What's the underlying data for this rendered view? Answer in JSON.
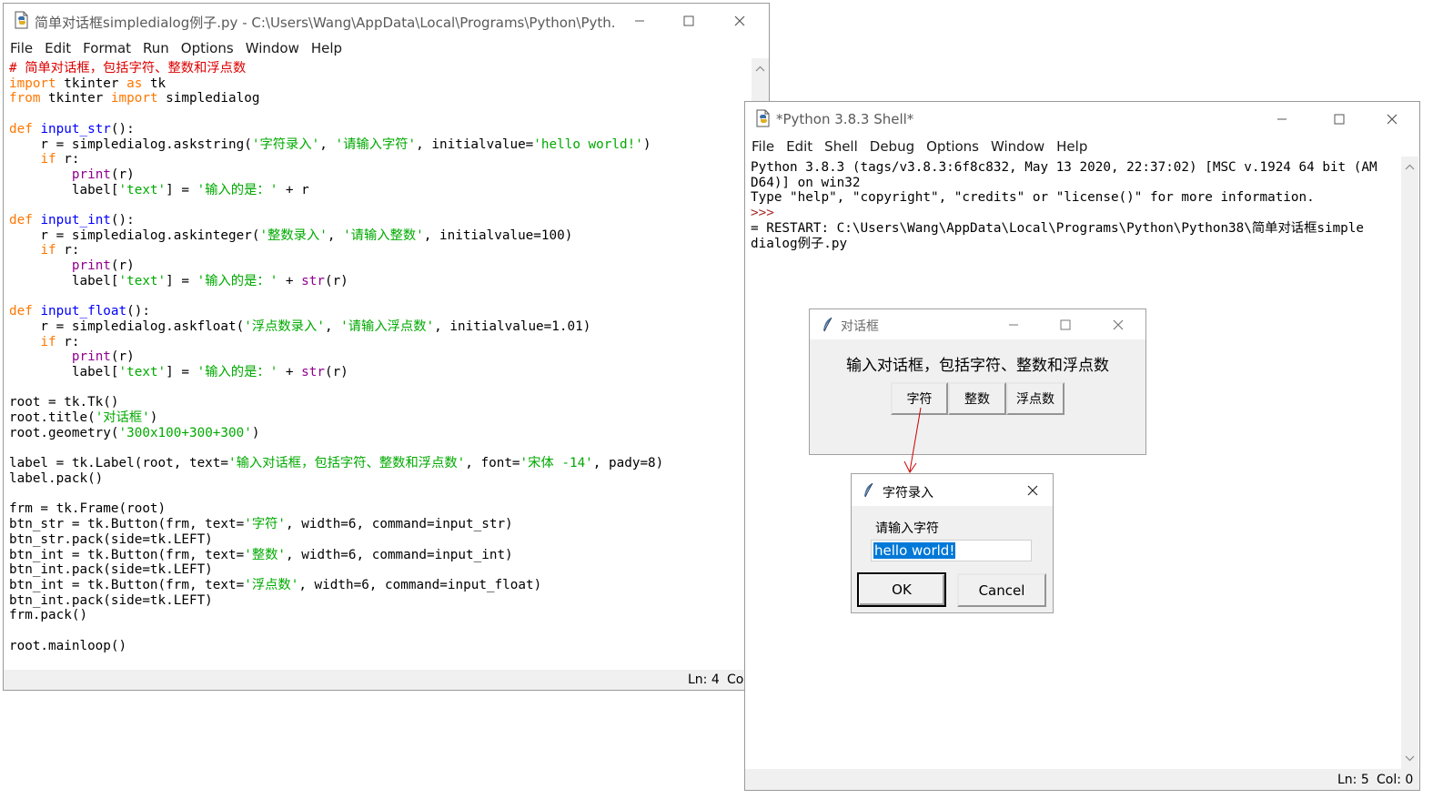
{
  "editor": {
    "title": "简单对话框simpledialog例子.py - C:\\Users\\Wang\\AppData\\Local\\Programs\\Python\\Pyth...",
    "menu": [
      "File",
      "Edit",
      "Format",
      "Run",
      "Options",
      "Window",
      "Help"
    ],
    "status_ln": "Ln: 4",
    "status_col": "Co"
  },
  "shell": {
    "title": "*Python 3.8.3 Shell*",
    "menu": [
      "File",
      "Edit",
      "Shell",
      "Debug",
      "Options",
      "Window",
      "Help"
    ],
    "lines": [
      "Python 3.8.3 (tags/v3.8.3:6f8c832, May 13 2020, 22:37:02) [MSC v.1924 64 bit (AM",
      "D64)] on win32",
      "Type \"help\", \"copyright\", \"credits\" or \"license()\" for more information.",
      ">>>",
      "= RESTART: C:\\Users\\Wang\\AppData\\Local\\Programs\\Python\\Python38\\简单对话框simple",
      "dialog例子.py"
    ],
    "status_ln": "Ln: 5",
    "status_col": "Col: 0"
  },
  "root_dialog": {
    "title": "对话框",
    "label": "输入对话框，包括字符、整数和浮点数",
    "buttons": [
      "字符",
      "整数",
      "浮点数"
    ]
  },
  "input_dialog": {
    "title": "字符录入",
    "prompt": "请输入字符",
    "value": "hello world!",
    "ok": "OK",
    "cancel": "Cancel"
  },
  "colors": {
    "keyword": "#ff7700",
    "definition": "#0000ff",
    "string": "#00aa00",
    "comment": "#dd0000",
    "builtin": "#900090",
    "annotation_arrow": "#cc0000"
  }
}
